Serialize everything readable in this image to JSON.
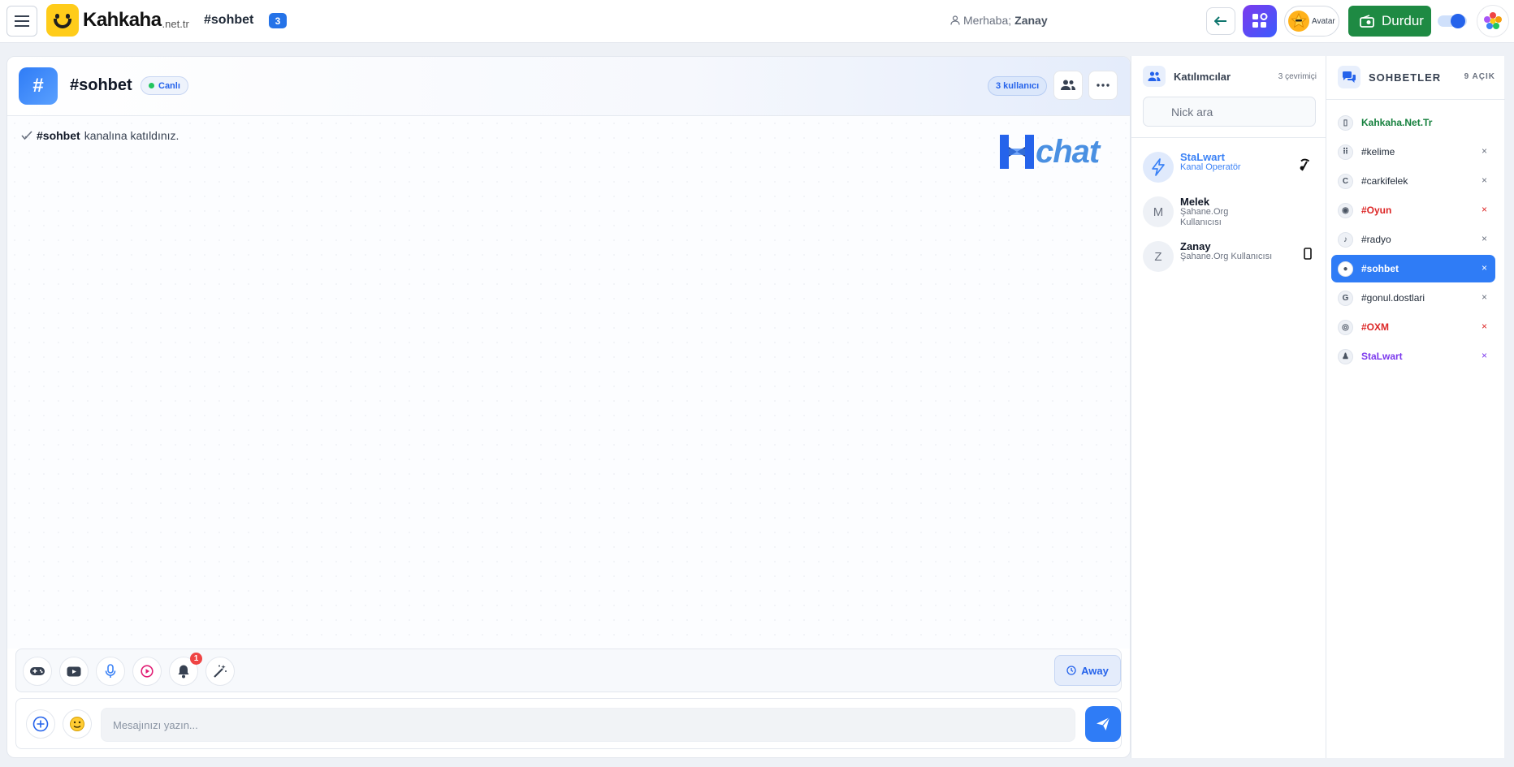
{
  "topbar": {
    "logo_text": "Kahkaha",
    "logo_suffix": ".net.tr",
    "channel": "#sohbet",
    "channel_badge": "3",
    "greeting_prefix": "Merhaba;",
    "greeting_user": "Zanay",
    "avatar_label": "Avatar",
    "stop_label": "Durdur"
  },
  "channel_header": {
    "hash": "#",
    "title": "#sohbet",
    "live_label": "Canlı",
    "users_count_label": "3 kullanıcı"
  },
  "messages": [
    {
      "channel": "#sohbet",
      "text": "kanalına katıldınız."
    }
  ],
  "brand_watermark": "chat",
  "toolbar": {
    "notification_count": "1",
    "away_label": "Away"
  },
  "composer": {
    "placeholder": "Mesajınızı yazın..."
  },
  "participants": {
    "title": "Katılımcılar",
    "online_count": "3 çevrimiçi",
    "search_placeholder": "Nick ara",
    "users": [
      {
        "initial": "",
        "name": "StaLwart",
        "role": "Kanal Operatör",
        "icon": "lightning-icon"
      },
      {
        "initial": "M",
        "name": "Melek",
        "role": "Şahane.Org Kullanıcısı",
        "icon": ""
      },
      {
        "initial": "Z",
        "name": "Zanay",
        "role": "Şahane.Org Kullanıcısı",
        "icon": "mobile-icon"
      }
    ]
  },
  "conversations": {
    "title": "SOHBETLER",
    "open_count": "9 AÇIK",
    "items": [
      {
        "icon": "▯",
        "name": "Kahkaha.Net.Tr",
        "color": "#15803d",
        "closable": false
      },
      {
        "icon": "⠿",
        "name": "#kelime",
        "color": "#1f2937",
        "closable": true
      },
      {
        "icon": "C",
        "name": "#carkifelek",
        "color": "#1f2937",
        "closable": true
      },
      {
        "icon": "◉",
        "name": "#Oyun",
        "color": "#dc2626",
        "closable": true
      },
      {
        "icon": "♪",
        "name": "#radyo",
        "color": "#1f2937",
        "closable": true
      },
      {
        "icon": "●",
        "name": "#sohbet",
        "color": "#ffffff",
        "closable": true,
        "active": true
      },
      {
        "icon": "G",
        "name": "#gonul.dostlari",
        "color": "#1f2937",
        "closable": true
      },
      {
        "icon": "◎",
        "name": "#OXM",
        "color": "#dc2626",
        "closable": true
      },
      {
        "icon": "♟",
        "name": "StaLwart",
        "color": "#7c3aed",
        "closable": true
      }
    ],
    "close_symbol": "×"
  }
}
